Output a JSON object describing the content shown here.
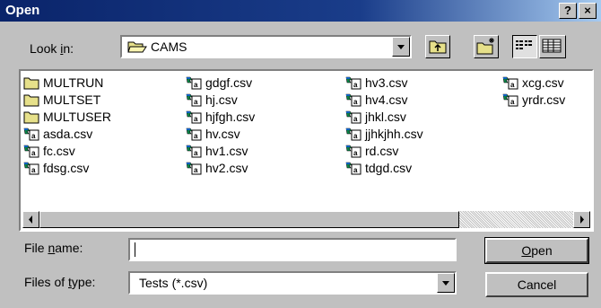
{
  "dialog": {
    "title": "Open",
    "help_label": "?",
    "close_label": "×"
  },
  "lookin": {
    "label_pre": "Look ",
    "label_ul": "i",
    "label_post": "n:",
    "value": "CAMS"
  },
  "toolbar": {
    "up_one_level": "up-folder-icon",
    "create_new_folder": "new-folder-icon",
    "list_view": "list-view-icon",
    "details_view": "details-view-icon"
  },
  "files": {
    "col1": [
      {
        "name": "MULTRUN",
        "icon": "folder-icon"
      },
      {
        "name": "MULTSET",
        "icon": "folder-icon"
      },
      {
        "name": "MULTUSER",
        "icon": "folder-icon"
      },
      {
        "name": "asda.csv",
        "icon": "csv-file-icon"
      },
      {
        "name": "fc.csv",
        "icon": "csv-file-icon"
      },
      {
        "name": "fdsg.csv",
        "icon": "csv-file-icon"
      }
    ],
    "col2": [
      {
        "name": "gdgf.csv",
        "icon": "csv-file-icon"
      },
      {
        "name": "hj.csv",
        "icon": "csv-file-icon"
      },
      {
        "name": "hjfgh.csv",
        "icon": "csv-file-icon"
      },
      {
        "name": "hv.csv",
        "icon": "csv-file-icon"
      },
      {
        "name": "hv1.csv",
        "icon": "csv-file-icon"
      },
      {
        "name": "hv2.csv",
        "icon": "csv-file-icon"
      }
    ],
    "col3": [
      {
        "name": "hv3.csv",
        "icon": "csv-file-icon"
      },
      {
        "name": "hv4.csv",
        "icon": "csv-file-icon"
      },
      {
        "name": "jhkl.csv",
        "icon": "csv-file-icon"
      },
      {
        "name": "jjhkjhh.csv",
        "icon": "csv-file-icon"
      },
      {
        "name": "rd.csv",
        "icon": "csv-file-icon"
      },
      {
        "name": "tdgd.csv",
        "icon": "csv-file-icon"
      }
    ],
    "col4": [
      {
        "name": "xcg.csv",
        "icon": "csv-file-icon"
      },
      {
        "name": "yrdr.csv",
        "icon": "csv-file-icon"
      }
    ]
  },
  "filename": {
    "label_pre": "File ",
    "label_ul": "n",
    "label_post": "ame:",
    "value": ""
  },
  "filetype": {
    "label_pre": "Files of ",
    "label_ul": "t",
    "label_post": "ype:",
    "value": "Tests (*.csv)"
  },
  "buttons": {
    "open_ul": "O",
    "open_rest": "pen",
    "cancel": "Cancel"
  }
}
